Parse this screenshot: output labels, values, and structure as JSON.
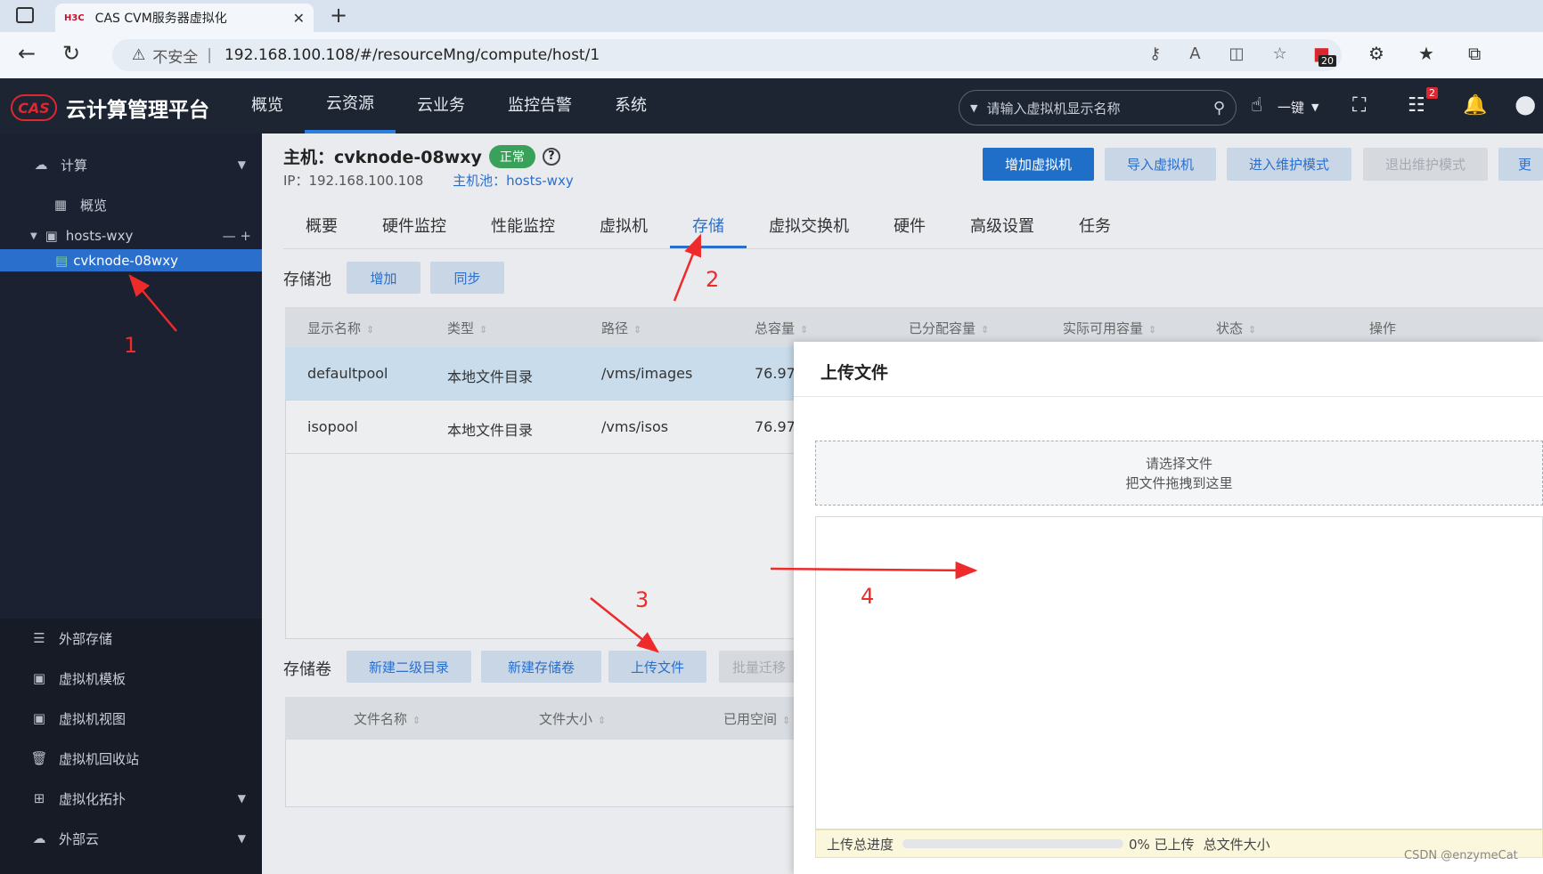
{
  "browser": {
    "tab_title": "CAS CVM服务器虚拟化",
    "tab_brand": "H3C",
    "url_warning": "不安全",
    "url": "192.168.100.108/#/resourceMng/compute/host/1",
    "ext_badge": "20"
  },
  "app": {
    "logo_text": "CAS",
    "name": "云计算管理平台",
    "nav": [
      "概览",
      "云资源",
      "云业务",
      "监控告警",
      "系统"
    ],
    "search_placeholder": "请输入虚拟机显示名称",
    "one_key": "一键",
    "notif_badge": "2"
  },
  "sidebar": {
    "compute": "计算",
    "overview": "概览",
    "pool": "hosts-wxy",
    "host": "cvknode-08wxy",
    "bottom_items": [
      "外部存储",
      "虚拟机模板",
      "虚拟机视图",
      "虚拟机回收站",
      "虚拟化拓扑",
      "外部云"
    ]
  },
  "host": {
    "title": "主机：cvknode-08wxy",
    "status": "正常",
    "ip": "IP：192.168.100.108",
    "pool_label": "主机池：hosts-wxy",
    "actions": [
      "增加虚拟机",
      "导入虚拟机",
      "进入维护模式",
      "退出维护模式",
      "更"
    ]
  },
  "subtabs": [
    "概要",
    "硬件监控",
    "性能监控",
    "虚拟机",
    "存储",
    "虚拟交换机",
    "硬件",
    "高级设置",
    "任务"
  ],
  "storage_pool": {
    "label": "存储池",
    "buttons": [
      "增加",
      "同步"
    ],
    "columns": [
      "显示名称",
      "类型",
      "路径",
      "总容量",
      "已分配容量",
      "实际可用容量",
      "状态",
      "操作"
    ],
    "rows": [
      {
        "name": "defaultpool",
        "type": "本地文件目录",
        "path": "/vms/images",
        "total": "76.97("
      },
      {
        "name": "isopool",
        "type": "本地文件目录",
        "path": "/vms/isos",
        "total": "76.97("
      }
    ]
  },
  "storage_volume": {
    "label": "存储卷",
    "buttons": [
      "新建二级目录",
      "新建存储卷",
      "上传文件",
      "批量迁移"
    ],
    "columns": [
      "文件名称",
      "文件大小",
      "已用空间"
    ]
  },
  "modal": {
    "title": "上传文件",
    "drop_line1": "请选择文件",
    "drop_line2": "把文件拖拽到这里",
    "progress_label": "上传总进度",
    "progress_value": 0,
    "progress_text": "0% 已上传",
    "total_size_label": "总文件大小"
  },
  "annotations": [
    "1",
    "2",
    "3",
    "4"
  ],
  "watermark": "CSDN @enzymeCat"
}
